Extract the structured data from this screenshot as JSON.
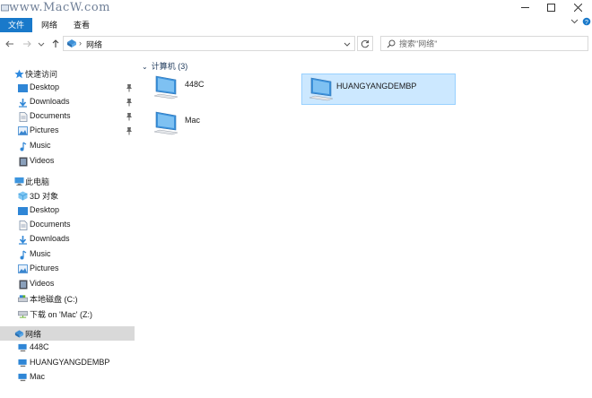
{
  "watermark": "www.MacW.com",
  "ribbon": {
    "tabs": [
      "文件",
      "网络",
      "查看"
    ]
  },
  "address": {
    "path": [
      "网络"
    ]
  },
  "search": {
    "placeholder": "搜索\"网络\""
  },
  "sidebar": {
    "quick_access": {
      "label": "快速访问",
      "items": [
        {
          "label": "Desktop",
          "icon": "desktop-icon",
          "pinned": true
        },
        {
          "label": "Downloads",
          "icon": "downloads-icon",
          "pinned": true
        },
        {
          "label": "Documents",
          "icon": "documents-icon",
          "pinned": true
        },
        {
          "label": "Pictures",
          "icon": "pictures-icon",
          "pinned": true
        },
        {
          "label": "Music",
          "icon": "music-icon",
          "pinned": false
        },
        {
          "label": "Videos",
          "icon": "videos-icon",
          "pinned": false
        }
      ]
    },
    "this_pc": {
      "label": "此电脑",
      "items": [
        {
          "label": "3D 对象",
          "icon": "3d-objects-icon"
        },
        {
          "label": "Desktop",
          "icon": "desktop-icon"
        },
        {
          "label": "Documents",
          "icon": "documents-icon"
        },
        {
          "label": "Downloads",
          "icon": "downloads-icon"
        },
        {
          "label": "Music",
          "icon": "music-icon"
        },
        {
          "label": "Pictures",
          "icon": "pictures-icon"
        },
        {
          "label": "Videos",
          "icon": "videos-icon"
        },
        {
          "label": "本地磁盘 (C:)",
          "icon": "local-disk-icon"
        },
        {
          "label": "下载 on 'Mac' (Z:)",
          "icon": "network-drive-icon"
        }
      ]
    },
    "network": {
      "label": "网络",
      "items": [
        {
          "label": "448C",
          "icon": "computer-icon"
        },
        {
          "label": "HUANGYANGDEMBP",
          "icon": "computer-icon"
        },
        {
          "label": "Mac",
          "icon": "computer-icon"
        }
      ]
    }
  },
  "content": {
    "group_label": "计算机 (3)",
    "computers": [
      {
        "name": "448C",
        "selected": false
      },
      {
        "name": "HUANGYANGDEMBP",
        "selected": true
      },
      {
        "name": "Mac",
        "selected": false
      }
    ]
  },
  "colors": {
    "accent": "#1979ca",
    "selection": "#cce8ff",
    "selection_border": "#99d1ff",
    "nav_selected": "#d9d9d9"
  }
}
